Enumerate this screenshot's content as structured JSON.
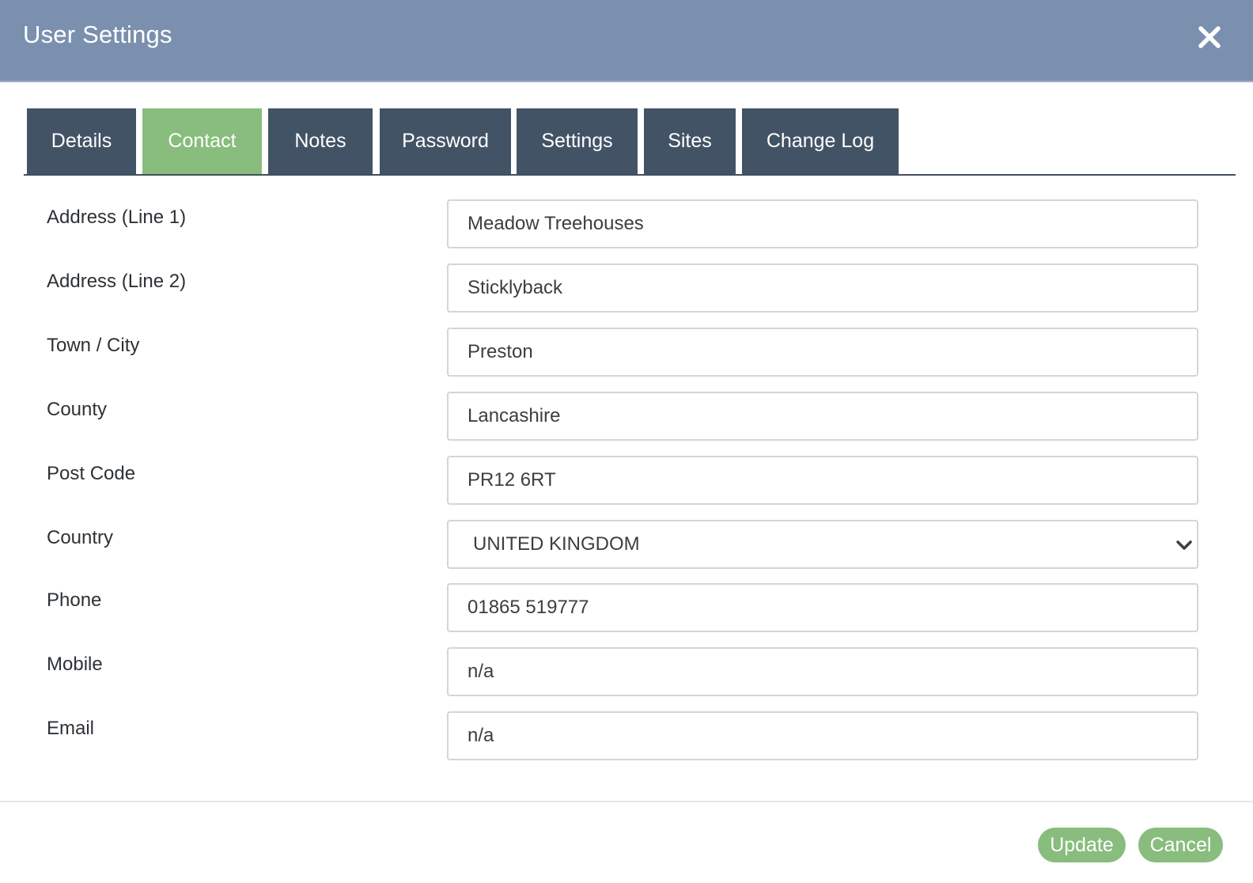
{
  "header": {
    "title": "User Settings",
    "close_icon": "close-icon"
  },
  "tabs": [
    {
      "label": "Details",
      "active": false
    },
    {
      "label": "Contact",
      "active": true
    },
    {
      "label": "Notes",
      "active": false
    },
    {
      "label": "Password",
      "active": false
    },
    {
      "label": "Settings",
      "active": false
    },
    {
      "label": "Sites",
      "active": false
    },
    {
      "label": "Change Log",
      "active": false
    }
  ],
  "form": {
    "address1": {
      "label": "Address (Line 1)",
      "value": "Meadow Treehouses"
    },
    "address2": {
      "label": "Address (Line 2)",
      "value": "Sticklyback"
    },
    "town": {
      "label": "Town / City",
      "value": "Preston"
    },
    "county": {
      "label": "County",
      "value": "Lancashire"
    },
    "postcode": {
      "label": "Post Code",
      "value": "PR12 6RT"
    },
    "country": {
      "label": "Country",
      "value": "UNITED KINGDOM",
      "chevron_icon": "chevron-down-icon"
    },
    "phone": {
      "label": "Phone",
      "value": "01865 519777"
    },
    "mobile": {
      "label": "Mobile",
      "value": "n/a"
    },
    "email": {
      "label": "Email",
      "value": "n/a"
    }
  },
  "footer": {
    "update_label": "Update",
    "cancel_label": "Cancel"
  },
  "colors": {
    "header_bg": "#7b90ae",
    "tab_bg": "#435366",
    "accent_green": "#88bd7d"
  }
}
